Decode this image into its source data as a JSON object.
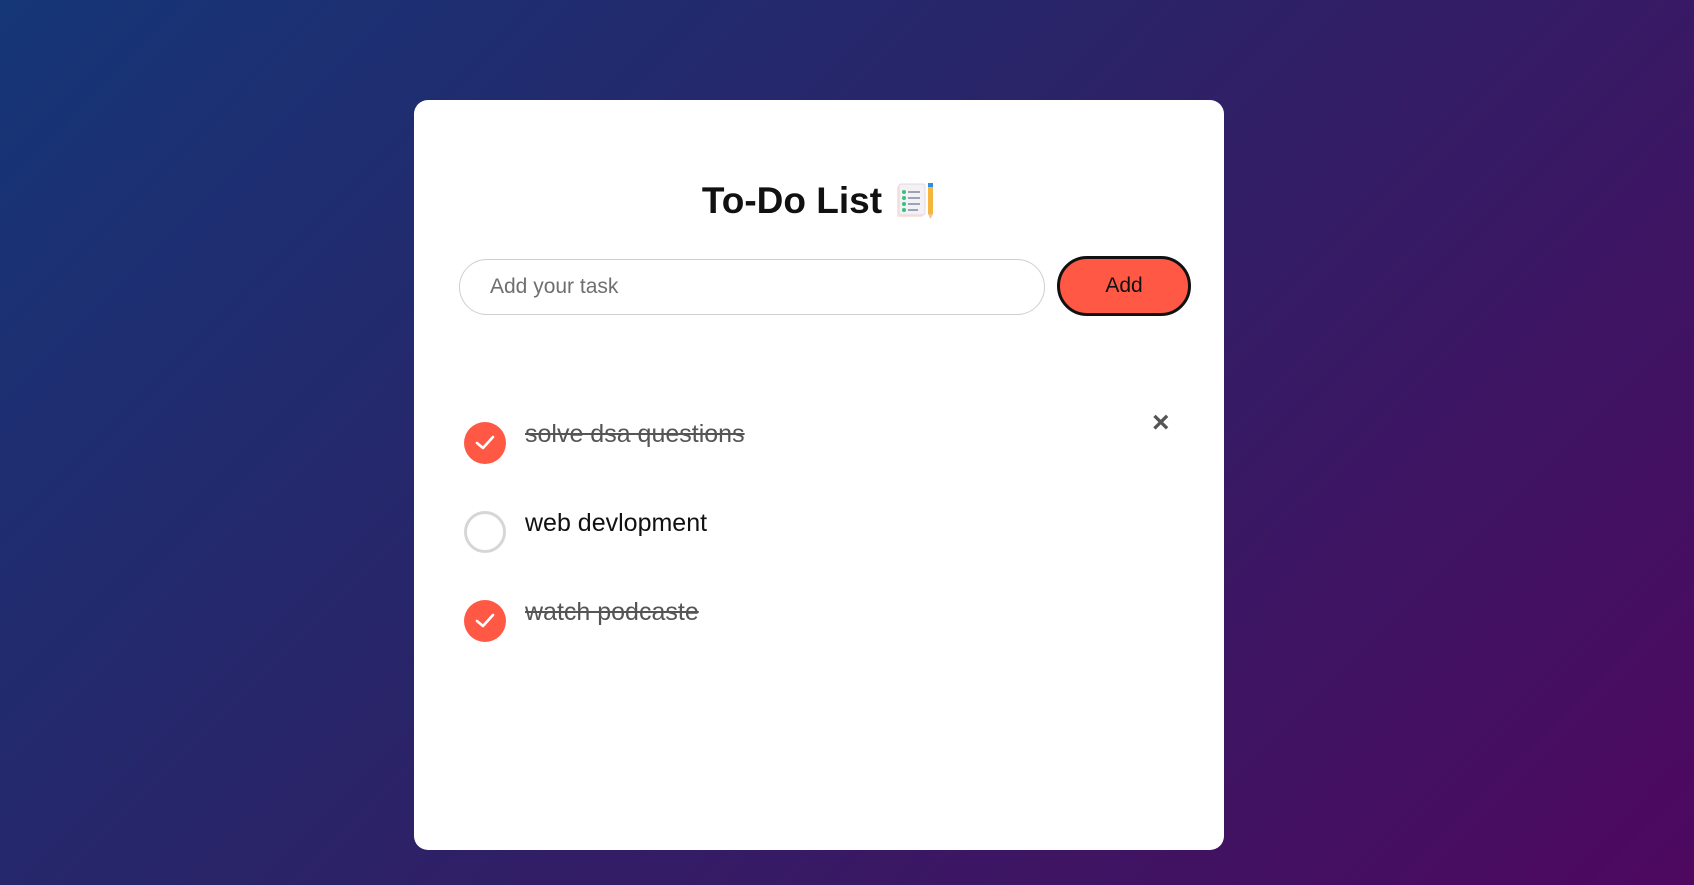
{
  "header": {
    "title": "To-Do List",
    "title_icon": "notepad-with-pencil-icon"
  },
  "add_task": {
    "placeholder": "Add your task",
    "value": "",
    "button_label": "Add"
  },
  "tasks": [
    {
      "text": "solve dsa questions",
      "completed": true,
      "show_delete": true,
      "delete_label": "×"
    },
    {
      "text": "web devlopment",
      "completed": false,
      "show_delete": false
    },
    {
      "text": "watch podcaste",
      "completed": true,
      "show_delete": false
    }
  ],
  "colors": {
    "accent": "#ff5945",
    "background_start": "#153677",
    "background_end": "#4e085f"
  }
}
